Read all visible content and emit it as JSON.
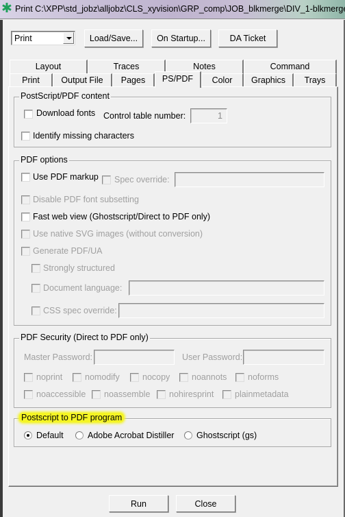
{
  "window": {
    "title": "Print C:\\XPP\\std_jobz\\alljobz\\CLS_xyvision\\GRP_comp\\JOB_blkmerge\\DIV_1-blkmerge",
    "icon": "asterisk-app-icon"
  },
  "toolbar": {
    "mode_select": {
      "value": "Print"
    },
    "load_save_label": "Load/Save...",
    "on_startup_label": "On Startup...",
    "da_ticket_label": "DA Ticket"
  },
  "tabs": {
    "back_row": [
      "Layout",
      "Traces",
      "Notes",
      "Command"
    ],
    "front_row": [
      "Print",
      "Output File",
      "Pages",
      "PS/PDF",
      "Color",
      "Graphics",
      "Trays"
    ],
    "active": "PS/PDF"
  },
  "ps_pdf_content": {
    "title": "PostScript/PDF content",
    "download_fonts": {
      "label": "Download fonts",
      "checked": false
    },
    "control_table_label": "Control table number:",
    "control_table_value": "1",
    "identify_missing": {
      "label": "Identify missing characters",
      "checked": false
    }
  },
  "pdf_options": {
    "title": "PDF options",
    "use_pdf_markup": {
      "label": "Use PDF markup",
      "checked": false
    },
    "spec_override": {
      "label": "Spec override:",
      "checked": false,
      "disabled": true,
      "value": ""
    },
    "disable_subsetting": {
      "label": "Disable PDF font subsetting",
      "checked": false,
      "disabled": true
    },
    "fast_web_view": {
      "label": "Fast web view (Ghostscript/Direct to PDF only)",
      "checked": false
    },
    "native_svg": {
      "label": "Use native SVG images (without conversion)",
      "checked": false,
      "disabled": true
    },
    "generate_pdfua": {
      "label": "Generate PDF/UA",
      "checked": false,
      "disabled": true
    },
    "strongly_structured": {
      "label": "Strongly structured",
      "checked": false,
      "disabled": true
    },
    "document_language": {
      "label": "Document language:",
      "checked": false,
      "disabled": true,
      "value": ""
    },
    "css_spec_override": {
      "label": "CSS spec override:",
      "checked": false,
      "disabled": true,
      "value": ""
    }
  },
  "pdf_security": {
    "title": "PDF Security (Direct to PDF only)",
    "master_password_label": "Master Password:",
    "master_password_value": "",
    "user_password_label": "User Password:",
    "user_password_value": "",
    "flags_row1": [
      "noprint",
      "nomodify",
      "nocopy",
      "noannots",
      "noforms"
    ],
    "flags_row2": [
      "noaccessible",
      "noassemble",
      "nohiresprint",
      "plainmetadata"
    ]
  },
  "ps_to_pdf": {
    "title": "Postscript to PDF program",
    "highlight_color": "#f5f524",
    "options": [
      "Default",
      "Adobe Acrobat Distiller",
      "Ghostscript (gs)"
    ],
    "selected": "Default"
  },
  "footer": {
    "run_label": "Run",
    "close_label": "Close"
  }
}
